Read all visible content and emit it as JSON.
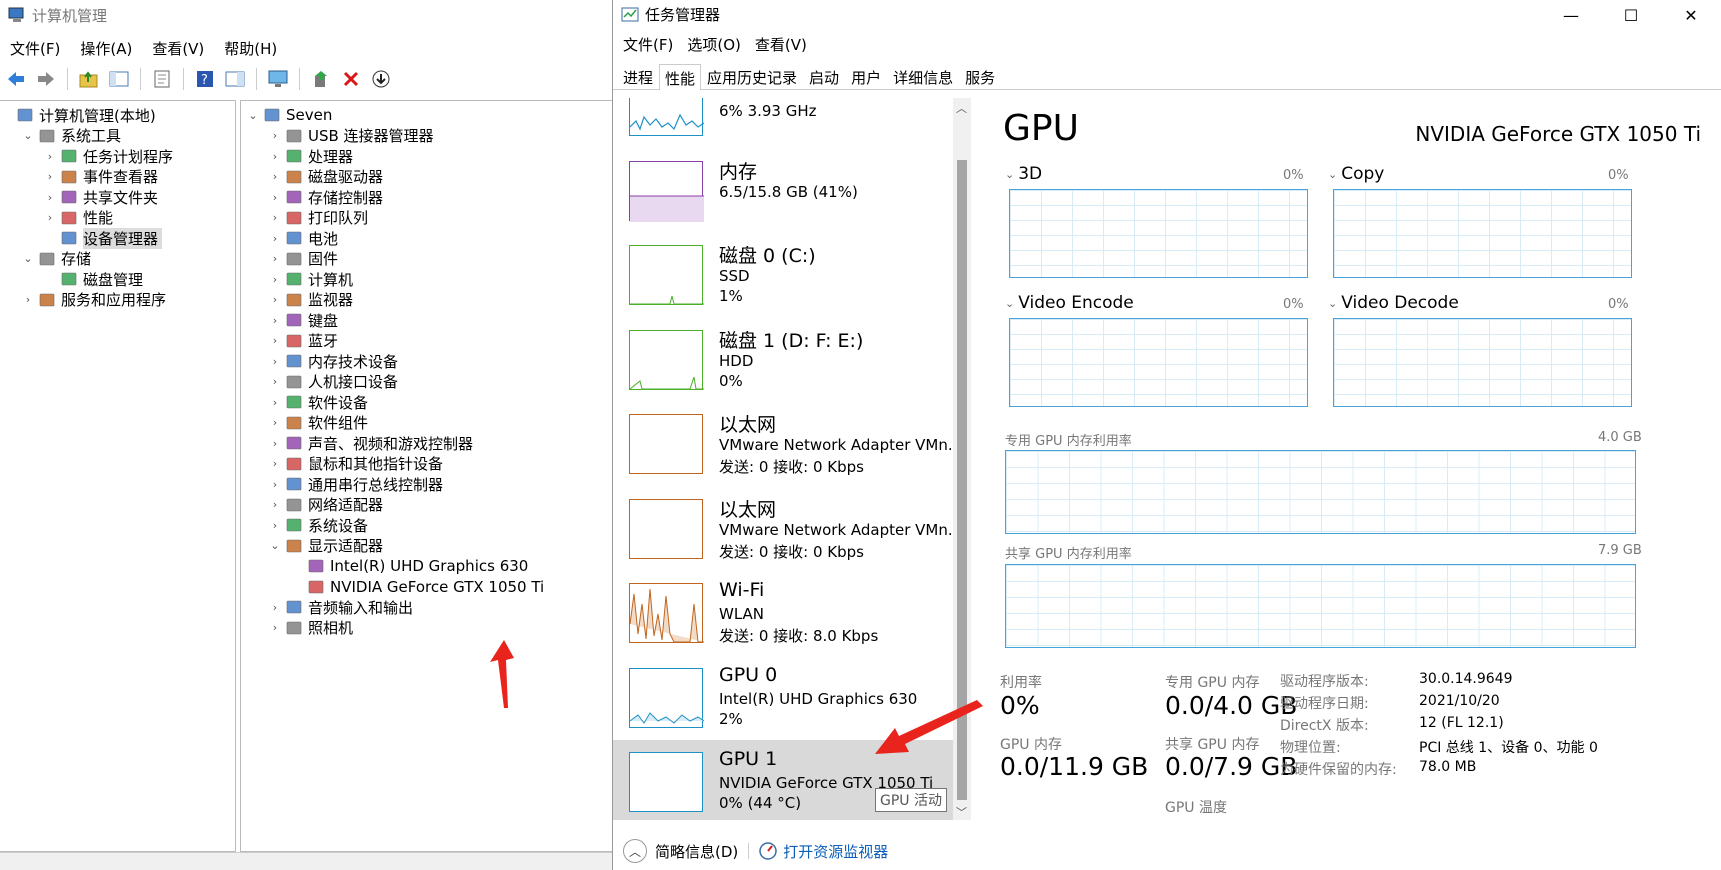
{
  "cm": {
    "title": "计算机管理",
    "menu": [
      "文件(F)",
      "操作(A)",
      "查看(V)",
      "帮助(H)"
    ],
    "left_tree": [
      {
        "label": "计算机管理(本地)",
        "chev": "",
        "indent": 0
      },
      {
        "label": "系统工具",
        "chev": "⌄",
        "indent": 1
      },
      {
        "label": "任务计划程序",
        "chev": "›",
        "indent": 2
      },
      {
        "label": "事件查看器",
        "chev": "›",
        "indent": 2
      },
      {
        "label": "共享文件夹",
        "chev": "›",
        "indent": 2
      },
      {
        "label": "性能",
        "chev": "›",
        "indent": 2
      },
      {
        "label": "设备管理器",
        "chev": "",
        "indent": 2,
        "selected": true
      },
      {
        "label": "存储",
        "chev": "⌄",
        "indent": 1
      },
      {
        "label": "磁盘管理",
        "chev": "",
        "indent": 2
      },
      {
        "label": "服务和应用程序",
        "chev": "›",
        "indent": 1
      }
    ],
    "device_tree": [
      {
        "label": "Seven",
        "chev": "⌄",
        "indent": 0
      },
      {
        "label": "USB 连接器管理器",
        "chev": "›",
        "indent": 1
      },
      {
        "label": "处理器",
        "chev": "›",
        "indent": 1
      },
      {
        "label": "磁盘驱动器",
        "chev": "›",
        "indent": 1
      },
      {
        "label": "存储控制器",
        "chev": "›",
        "indent": 1
      },
      {
        "label": "打印队列",
        "chev": "›",
        "indent": 1
      },
      {
        "label": "电池",
        "chev": "›",
        "indent": 1
      },
      {
        "label": "固件",
        "chev": "›",
        "indent": 1
      },
      {
        "label": "计算机",
        "chev": "›",
        "indent": 1
      },
      {
        "label": "监视器",
        "chev": "›",
        "indent": 1
      },
      {
        "label": "键盘",
        "chev": "›",
        "indent": 1
      },
      {
        "label": "蓝牙",
        "chev": "›",
        "indent": 1
      },
      {
        "label": "内存技术设备",
        "chev": "›",
        "indent": 1
      },
      {
        "label": "人机接口设备",
        "chev": "›",
        "indent": 1
      },
      {
        "label": "软件设备",
        "chev": "›",
        "indent": 1
      },
      {
        "label": "软件组件",
        "chev": "›",
        "indent": 1
      },
      {
        "label": "声音、视频和游戏控制器",
        "chev": "›",
        "indent": 1
      },
      {
        "label": "鼠标和其他指针设备",
        "chev": "›",
        "indent": 1
      },
      {
        "label": "通用串行总线控制器",
        "chev": "›",
        "indent": 1
      },
      {
        "label": "网络适配器",
        "chev": "›",
        "indent": 1
      },
      {
        "label": "系统设备",
        "chev": "›",
        "indent": 1
      },
      {
        "label": "显示适配器",
        "chev": "⌄",
        "indent": 1
      },
      {
        "label": "Intel(R) UHD Graphics 630",
        "chev": "",
        "indent": 2
      },
      {
        "label": "NVIDIA GeForce GTX 1050 Ti",
        "chev": "",
        "indent": 2
      },
      {
        "label": "音频输入和输出",
        "chev": "›",
        "indent": 1
      },
      {
        "label": "照相机",
        "chev": "›",
        "indent": 1
      }
    ]
  },
  "tm": {
    "title": "任务管理器",
    "win_controls": [
      "—",
      "☐",
      "✕"
    ],
    "menu": [
      "文件(F)",
      "选项(O)",
      "查看(V)"
    ],
    "tabs": [
      "进程",
      "性能",
      "应用历史记录",
      "启动",
      "用户",
      "详细信息",
      "服务"
    ],
    "active_tab": 1,
    "side": [
      {
        "name": "",
        "sub": "6% 3.93 GHz",
        "sub2": "",
        "color": "#1e90c8",
        "partial": true
      },
      {
        "name": "内存",
        "sub": "6.5/15.8 GB (41%)",
        "sub2": "",
        "color": "#8b3fa8"
      },
      {
        "name": "磁盘 0 (C:)",
        "sub": "SSD",
        "sub2": "1%",
        "color": "#4caf2a"
      },
      {
        "name": "磁盘 1 (D: F: E:)",
        "sub": "HDD",
        "sub2": "0%",
        "color": "#4caf2a"
      },
      {
        "name": "以太网",
        "sub": "VMware Network Adapter VMn.",
        "sub2": "发送: 0 接收: 0 Kbps",
        "color": "#c0651f"
      },
      {
        "name": "以太网",
        "sub": "VMware Network Adapter VMn.",
        "sub2": "发送: 0 接收: 0 Kbps",
        "color": "#c0651f"
      },
      {
        "name": "Wi-Fi",
        "sub": "WLAN",
        "sub2": "发送: 0 接收: 8.0 Kbps",
        "color": "#c0651f"
      },
      {
        "name": "GPU 0",
        "sub": "Intel(R) UHD Graphics 630",
        "sub2": "2%",
        "color": "#1e90c8"
      },
      {
        "name": "GPU 1",
        "sub": "NVIDIA GeForce GTX 1050 Ti",
        "sub2": "0% (44 °C)",
        "color": "#1e90c8",
        "active": true
      }
    ],
    "tooltip": "GPU 活动",
    "footer": {
      "brief": "简略信息(D)",
      "monitor": "打开资源监视器"
    },
    "gpu": {
      "title": "GPU",
      "model": "NVIDIA GeForce GTX 1050 Ti",
      "engines": [
        {
          "name": "3D",
          "pct": "0%"
        },
        {
          "name": "Copy",
          "pct": "0%"
        },
        {
          "name": "Video Encode",
          "pct": "0%"
        },
        {
          "name": "Video Decode",
          "pct": "0%"
        }
      ],
      "dedicated_label": "专用 GPU 内存利用率",
      "dedicated_max": "4.0 GB",
      "shared_label": "共享 GPU 内存利用率",
      "shared_max": "7.9 GB",
      "stats": {
        "util_label": "利用率",
        "util": "0%",
        "gpumem_label": "GPU 内存",
        "gpumem": "0.0/11.9 GB",
        "ded_label": "专用 GPU 内存",
        "ded": "0.0/4.0 GB",
        "shr_label": "共享 GPU 内存",
        "shr": "0.0/7.9 GB",
        "temp_label": "GPU 温度"
      },
      "info": [
        {
          "k": "驱动程序版本:",
          "v": "30.0.14.9649"
        },
        {
          "k": "驱动程序日期:",
          "v": "2021/10/20"
        },
        {
          "k": "DirectX 版本:",
          "v": "12 (FL 12.1)"
        },
        {
          "k": "物理位置:",
          "v": "PCI 总线 1、设备 0、功能 0"
        },
        {
          "k": "为硬件保留的内存:",
          "v": "78.0 MB"
        }
      ]
    }
  },
  "colors": {
    "arrow": "#e8241c",
    "graph_blue": "#4aa3d8",
    "selected": "#d9d9d9"
  }
}
